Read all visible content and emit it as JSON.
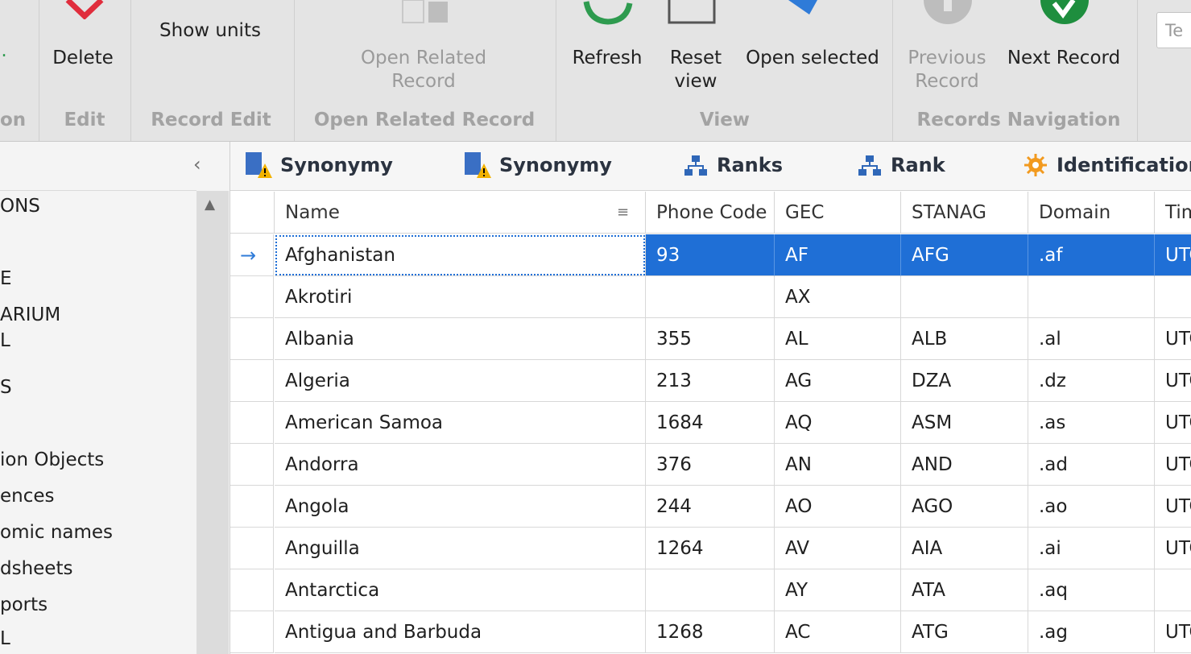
{
  "ribbon": {
    "buttons": {
      "delete": "Delete",
      "show_units": "Show units",
      "open_related": "Open Related Record",
      "refresh": "Refresh",
      "reset_view": "Reset view",
      "open_selected": "Open selected",
      "previous_record": "Previous Record",
      "next_record": "Next Record"
    },
    "groups": {
      "partial": "on",
      "edit": "Edit",
      "record_edit": "Record Edit",
      "open_related": "Open Related Record",
      "view": "View",
      "records_navigation": "Records Navigation"
    },
    "search_placeholder": "Te"
  },
  "left_panel": {
    "items": [
      "ONS",
      "E",
      "ARIUM",
      "L",
      "S",
      "ion Objects",
      "ences",
      "omic names",
      "dsheets",
      "ports",
      "L"
    ]
  },
  "tabs": [
    {
      "label": "Synonymy",
      "icon": "book-warning-icon"
    },
    {
      "label": "Synonymy",
      "icon": "book-warning-icon"
    },
    {
      "label": "Ranks",
      "icon": "hierarchy-icon"
    },
    {
      "label": "Rank",
      "icon": "hierarchy-icon"
    },
    {
      "label": "Identification",
      "icon": "gear-sun-icon"
    }
  ],
  "grid": {
    "columns": [
      "Name",
      "Phone Code",
      "GEC",
      "STANAG",
      "Domain",
      "Tim"
    ],
    "rows": [
      [
        "Afghanistan",
        "93",
        "AF",
        "AFG",
        ".af",
        "UTC"
      ],
      [
        "Akrotiri",
        "",
        "AX",
        "",
        "",
        ""
      ],
      [
        "Albania",
        "355",
        "AL",
        "ALB",
        ".al",
        "UTC"
      ],
      [
        "Algeria",
        "213",
        "AG",
        "DZA",
        ".dz",
        "UTC"
      ],
      [
        "American Samoa",
        "1684",
        "AQ",
        "ASM",
        ".as",
        "UTC"
      ],
      [
        "Andorra",
        "376",
        "AN",
        "AND",
        ".ad",
        "UTC"
      ],
      [
        "Angola",
        "244",
        "AO",
        "AGO",
        ".ao",
        "UTC"
      ],
      [
        "Anguilla",
        "1264",
        "AV",
        "AIA",
        ".ai",
        "UTC"
      ],
      [
        "Antarctica",
        "",
        "AY",
        "ATA",
        ".aq",
        ""
      ],
      [
        "Antigua and Barbuda",
        "1268",
        "AC",
        "ATG",
        ".ag",
        "UTC"
      ]
    ],
    "selected_row": 0
  },
  "colors": {
    "selection": "#1f6fd6",
    "delete_red": "#e02d3c",
    "refresh_green": "#2e9b4f",
    "arrow_blue": "#2f7bd8",
    "nav_green": "#1e8e3e"
  }
}
